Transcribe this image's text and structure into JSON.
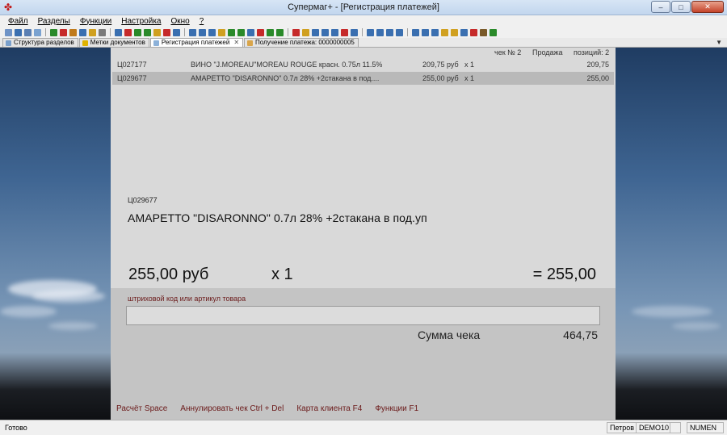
{
  "window": {
    "title": "Супермаг+  - [Регистрация платежей]",
    "buttons": {
      "minimize": "–",
      "maximize": "□",
      "close": "✕"
    }
  },
  "menu": [
    "Файл",
    "Разделы",
    "Функции",
    "Настройка",
    "Окно",
    "?"
  ],
  "tabs": [
    {
      "label": "Структура разделов",
      "active": false
    },
    {
      "label": "Метки документов",
      "active": false
    },
    {
      "label": "Регистрация платежей",
      "active": true
    },
    {
      "label": "Получение платежа: 0000000005",
      "active": false
    }
  ],
  "check_header": {
    "check_no": "чек №  2",
    "mode": "Продажа",
    "positions": "позиций:  2"
  },
  "items": [
    {
      "code": "Ц027177",
      "name": "ВИНО \"J.MOREAU\"MOREAU ROUGE красн. 0.75л 11.5%",
      "price": "209,75 руб",
      "qty": "x 1",
      "sum": "209,75",
      "selected": false
    },
    {
      "code": "Ц029677",
      "name": "АМАРЕТТО \"DISARONNO\"  0.7л 28% +2стакана в под....",
      "price": "255,00 руб",
      "qty": "x 1",
      "sum": "255,00",
      "selected": true
    }
  ],
  "current_item": {
    "code": "Ц029677",
    "name": "АМАРЕТТО \"DISARONNO\"  0.7л 28% +2стакана в под.уп",
    "price": "255,00 руб",
    "qty": "x 1",
    "total": "= 255,00"
  },
  "barcode": {
    "label": "штриховой код или артикул товара",
    "value": ""
  },
  "check_sum": {
    "label": "Сумма чека",
    "value": "464,75"
  },
  "hotkeys": [
    "Расчёт Space",
    "Аннулировать чек Ctrl + Del",
    "Карта клиента F4",
    "Функции F1"
  ],
  "status": {
    "ready": "Готово",
    "user": "Петров",
    "db": "DEMO10",
    "numlock": "NUMEN"
  },
  "colors": {
    "hint_text": "#6b1a1a",
    "panel_bg": "#d9d9d9",
    "selected_row": "#b9b9b9"
  }
}
